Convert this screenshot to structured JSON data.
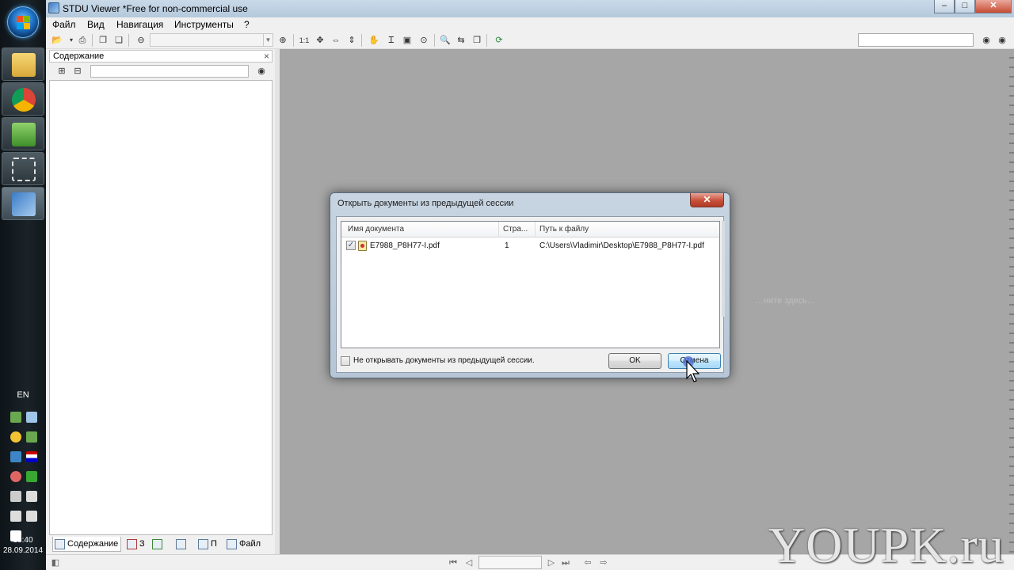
{
  "window": {
    "title": "STDU Viewer *Free for non-commercial use",
    "controls": {
      "minimize": "–",
      "maximize": "□",
      "close": "✕"
    }
  },
  "menu": {
    "file": "Файл",
    "view": "Вид",
    "navigation": "Навигация",
    "tools": "Инструменты",
    "help": "?"
  },
  "toolbar": {
    "zoom_actual": "1:1",
    "page_value": "",
    "search_value": ""
  },
  "left_panel": {
    "title": "Содержание",
    "close": "×",
    "search_value": "",
    "tabs": [
      "Содержание",
      "З",
      "",
      "",
      "П",
      "Файл"
    ]
  },
  "document_area": {
    "hint": "…ните здесь..."
  },
  "dialog": {
    "title": "Открыть документы из предыдущей сессии",
    "close": "✕",
    "columns": [
      "Имя документа",
      "Стра...",
      "Путь к файлу"
    ],
    "rows": [
      {
        "checked": "✓",
        "name": "E7988_P8H77-I.pdf",
        "pages": "1",
        "path": "C:\\Users\\Vladimir\\Desktop\\E7988_P8H77-I.pdf"
      }
    ],
    "dont_open_label": "Не открывать документы из предыдущей сессии.",
    "ok_label": "OK",
    "cancel_label": "Отмена"
  },
  "taskbar": {
    "language": "EN",
    "time": "18:40",
    "date": "28.09.2014"
  },
  "watermark": "YOUPK.ru",
  "icons": {
    "open": "📂",
    "print": "⎙",
    "zoom_out": "⊖",
    "zoom_in": "⊕",
    "hand": "✋",
    "find": "🔍",
    "back": "⇦",
    "forward": "⇨"
  },
  "colors": {
    "doc_bg": "#a6a6a6",
    "dialog_frame": "#b6c6d6",
    "close_red": "#c7503a"
  }
}
